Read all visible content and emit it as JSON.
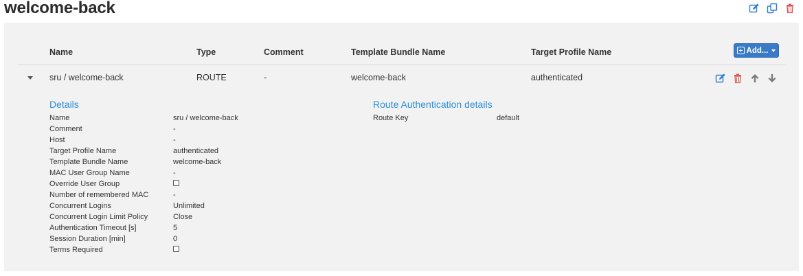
{
  "page": {
    "title": "welcome-back"
  },
  "top_actions": [
    {
      "icon": "edit-icon",
      "color": "#2d7dd2"
    },
    {
      "icon": "copy-icon",
      "color": "#2d7dd2"
    },
    {
      "icon": "trash-icon",
      "color": "#d9534f"
    }
  ],
  "table": {
    "headers": {
      "name": "Name",
      "type": "Type",
      "comment": "Comment",
      "template_bundle_name": "Template Bundle Name",
      "target_profile_name": "Target Profile Name"
    },
    "add_button_label": "Add...",
    "row": {
      "name": "sru / welcome-back",
      "type": "ROUTE",
      "comment": "-",
      "template_bundle_name": "welcome-back",
      "target_profile_name": "authenticated"
    }
  },
  "details": {
    "title": "Details",
    "items": [
      {
        "label": "Name",
        "value": "sru / welcome-back",
        "checkbox": false
      },
      {
        "label": "Comment",
        "value": "-",
        "checkbox": false
      },
      {
        "label": "Host",
        "value": "-",
        "checkbox": false
      },
      {
        "label": "Target Profile Name",
        "value": "authenticated",
        "checkbox": false
      },
      {
        "label": "Template Bundle Name",
        "value": "welcome-back",
        "checkbox": false
      },
      {
        "label": "MAC User Group Name",
        "value": "-",
        "checkbox": false
      },
      {
        "label": "Override User Group",
        "value": "",
        "checkbox": true
      },
      {
        "label": "Number of remembered MAC",
        "value": "-",
        "checkbox": false
      },
      {
        "label": "Concurrent Logins",
        "value": "Unlimited",
        "checkbox": false
      },
      {
        "label": "Concurrent Login Limit Policy",
        "value": "Close",
        "checkbox": false
      },
      {
        "label": "Authentication Timeout [s]",
        "value": "5",
        "checkbox": false
      },
      {
        "label": "Session Duration [min]",
        "value": "0",
        "checkbox": false
      },
      {
        "label": "Terms Required",
        "value": "",
        "checkbox": true
      }
    ]
  },
  "route_auth": {
    "title": "Route Authentication details",
    "items": [
      {
        "label": "Route Key",
        "value": "default"
      }
    ]
  },
  "colors": {
    "accent": "#2d8fd6",
    "button": "#3a7bc8",
    "danger": "#d9534f",
    "panel_bg": "#f2f2f2"
  }
}
